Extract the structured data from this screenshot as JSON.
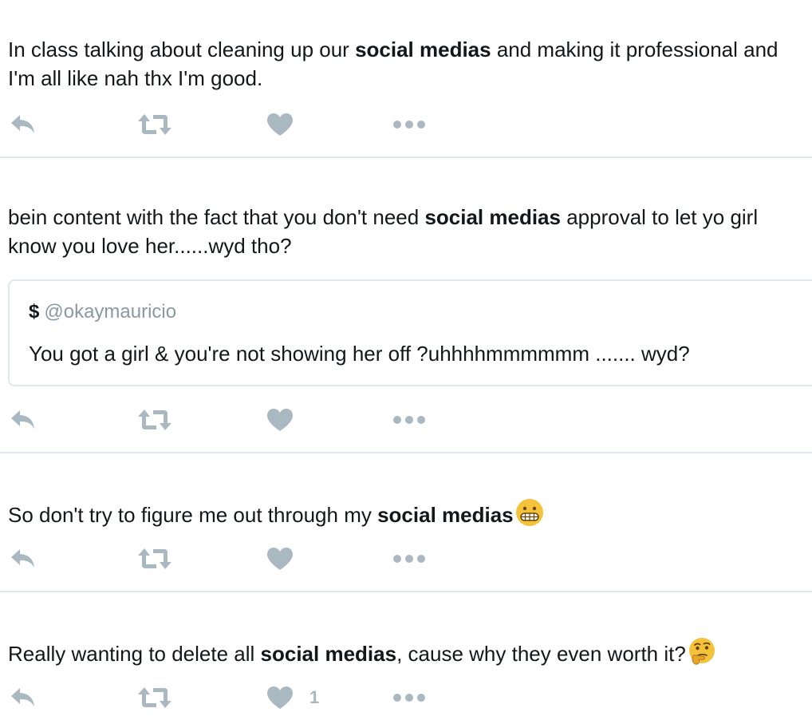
{
  "colors": {
    "text": "#14171a",
    "action_icon": "#aab8c2",
    "divider": "#e1e8ed",
    "handle": "#8899a6",
    "emoji": "#f5c33b"
  },
  "tweets": [
    {
      "text_before": "In class talking about cleaning up our ",
      "bold": "social medias",
      "text_after": " and making it professional and I'm all like nah thx I'm good.",
      "actions": {
        "reply_icon": "reply-icon",
        "retweet_icon": "retweet-icon",
        "like_icon": "heart-icon",
        "more_icon": "more-icon"
      }
    },
    {
      "text_before": "bein content with the fact that you don't need ",
      "bold": "social medias",
      "text_after": " approval to let yo girl know you love her......wyd tho?",
      "quote": {
        "name": "$",
        "handle": "@okaymauricio",
        "text": "You got a girl & you're not showing her off ?uhhhhmmmmmm ....... wyd?"
      }
    },
    {
      "text_before": "So don't try to figure me out through my ",
      "bold": "social medias",
      "text_after": "",
      "emoji": "grimacing-face-emoji"
    },
    {
      "text_before": "Really wanting to delete all ",
      "bold": "social medias",
      "text_after": ", cause why they even worth it?",
      "emoji": "thinking-face-emoji",
      "like_count": "1"
    }
  ]
}
